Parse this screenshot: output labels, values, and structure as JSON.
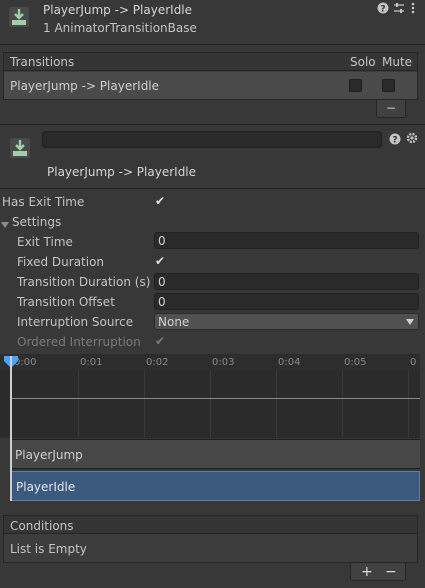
{
  "header": {
    "title": "PlayerJump -> PlayerIdle",
    "subtitle": "1 AnimatorTransitionBase",
    "help_icon": "help-icon",
    "preset_icon": "preset-sliders-icon",
    "menu_icon": "kebab-menu-icon"
  },
  "transitions": {
    "title": "Transitions",
    "col_solo": "Solo",
    "col_mute": "Mute",
    "rows": [
      {
        "label": "PlayerJump -> PlayerIdle",
        "solo": false,
        "mute": false
      }
    ],
    "remove_label": "−"
  },
  "inspector": {
    "name_value": "",
    "title": "PlayerJump -> PlayerIdle",
    "has_exit_time_label": "Has Exit Time",
    "settings_label": "Settings",
    "exit_time_label": "Exit Time",
    "exit_time_value": "0",
    "fixed_duration_label": "Fixed Duration",
    "transition_duration_label": "Transition Duration (s)",
    "transition_duration_value": "0",
    "transition_offset_label": "Transition Offset",
    "transition_offset_value": "0",
    "interruption_source_label": "Interruption Source",
    "interruption_source_value": "None",
    "ordered_interruption_label": "Ordered Interruption",
    "check": "✔"
  },
  "timeline": {
    "ticks": [
      "0:00",
      "0:01",
      "0:02",
      "0:03",
      "0:04",
      "0:05",
      "0"
    ],
    "state_from": "PlayerJump",
    "state_to": "PlayerIdle"
  },
  "conditions": {
    "title": "Conditions",
    "empty_text": "List is Empty",
    "add_label": "+",
    "remove_label": "−"
  },
  "colors": {
    "background": "#383838",
    "accent_blue": "#3b5a7d",
    "playhead": "#4aa3ff"
  }
}
